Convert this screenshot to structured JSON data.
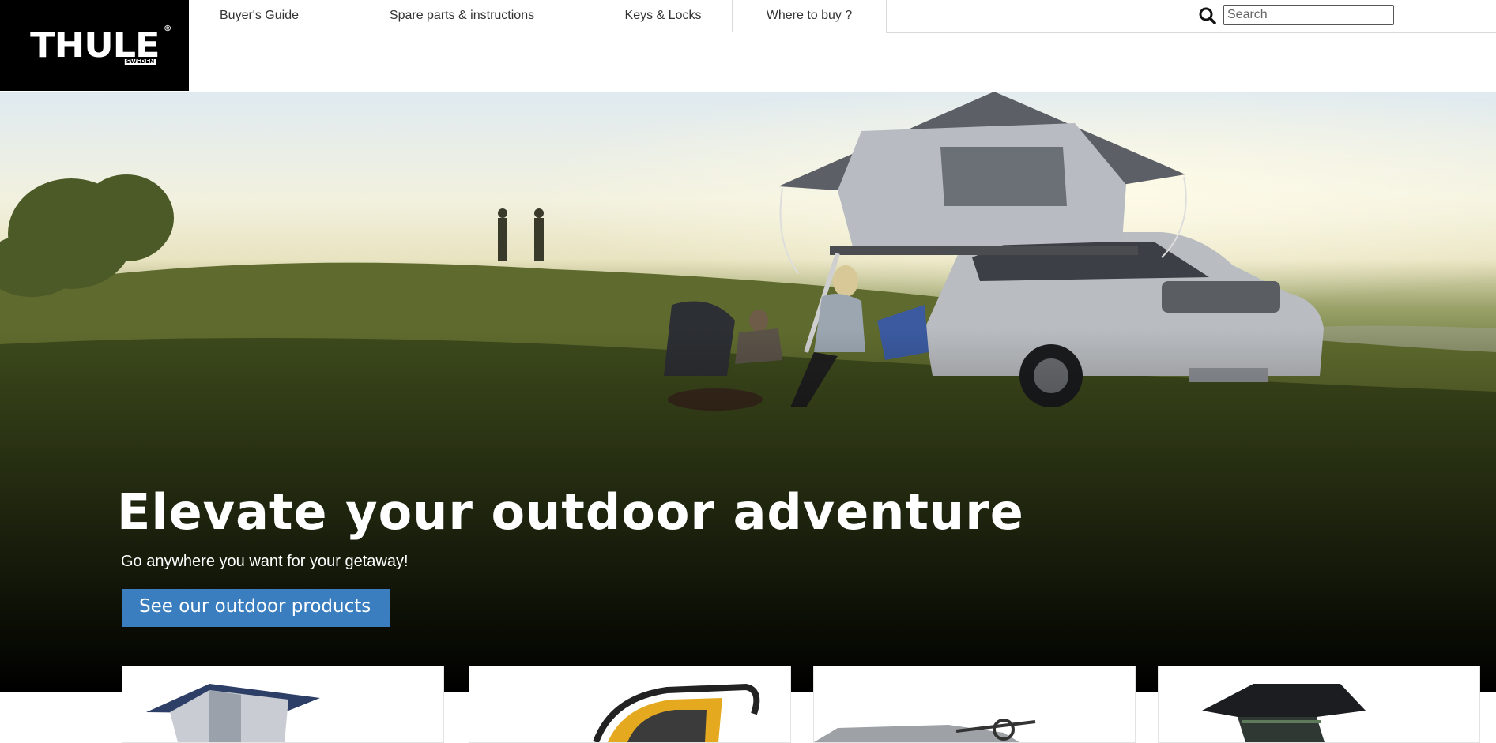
{
  "brand": {
    "name": "THULE",
    "sub": "SWEDEN",
    "reg": "®"
  },
  "nav": {
    "items": [
      {
        "label": "Buyer's Guide"
      },
      {
        "label": "Spare parts & instructions"
      },
      {
        "label": "Keys & Locks"
      },
      {
        "label": "Where to buy ?"
      }
    ]
  },
  "search": {
    "placeholder": "Search",
    "value": ""
  },
  "hero": {
    "title": "Elevate your outdoor adventure",
    "subtitle": "Go anywhere you want for your getaway!",
    "cta_label": "See our outdoor products"
  },
  "cards": [
    {
      "icon": "rooftop-tent-icon"
    },
    {
      "icon": "bike-trailer-icon"
    },
    {
      "icon": "bike-rack-icon"
    },
    {
      "icon": "rooftop-tent-dark-icon"
    }
  ],
  "colors": {
    "cta": "#3a7ebf",
    "logo_bg": "#000000"
  }
}
